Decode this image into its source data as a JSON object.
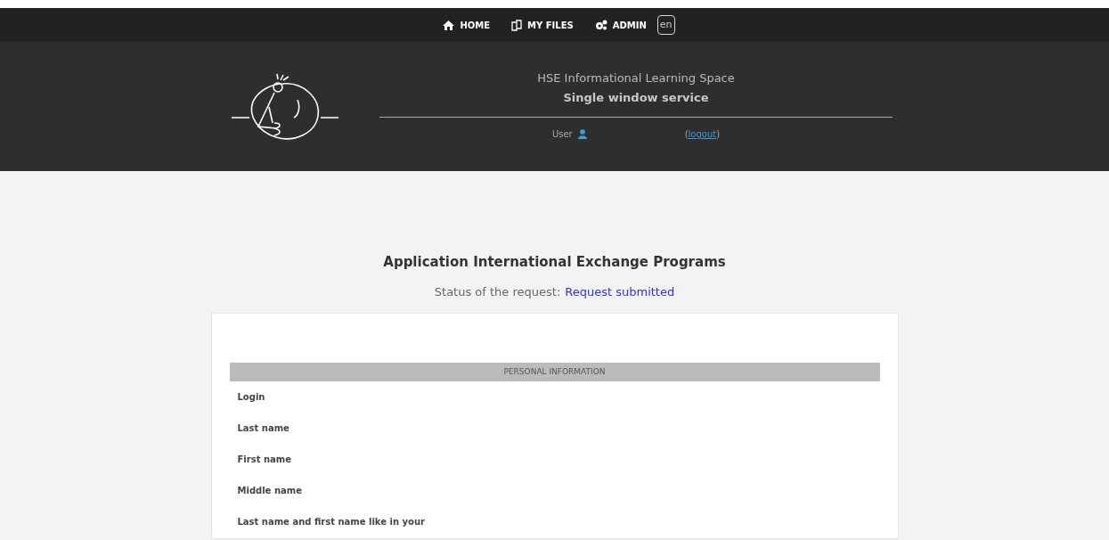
{
  "nav": [
    {
      "kind": "home",
      "label": "HOME"
    },
    {
      "kind": "files",
      "label": "MY FILES"
    },
    {
      "kind": "admin",
      "label": "ADMIN"
    }
  ],
  "language": "en",
  "header": {
    "title": "HSE Informational Learning Space",
    "subtitle": "Single window service",
    "user_label": "User",
    "logout_open": "(",
    "logout": "logout",
    "logout_close": ")"
  },
  "page_title": "Application International Exchange Programs",
  "status": {
    "label": "Status of the request:",
    "value": "Request submitted"
  },
  "section": "PERSONAL INFORMATION",
  "fields": [
    {
      "label": "Login"
    },
    {
      "label": "Last name"
    },
    {
      "label": "First name"
    },
    {
      "label": "Middle name"
    },
    {
      "label": "Last name and first name like in your"
    }
  ]
}
